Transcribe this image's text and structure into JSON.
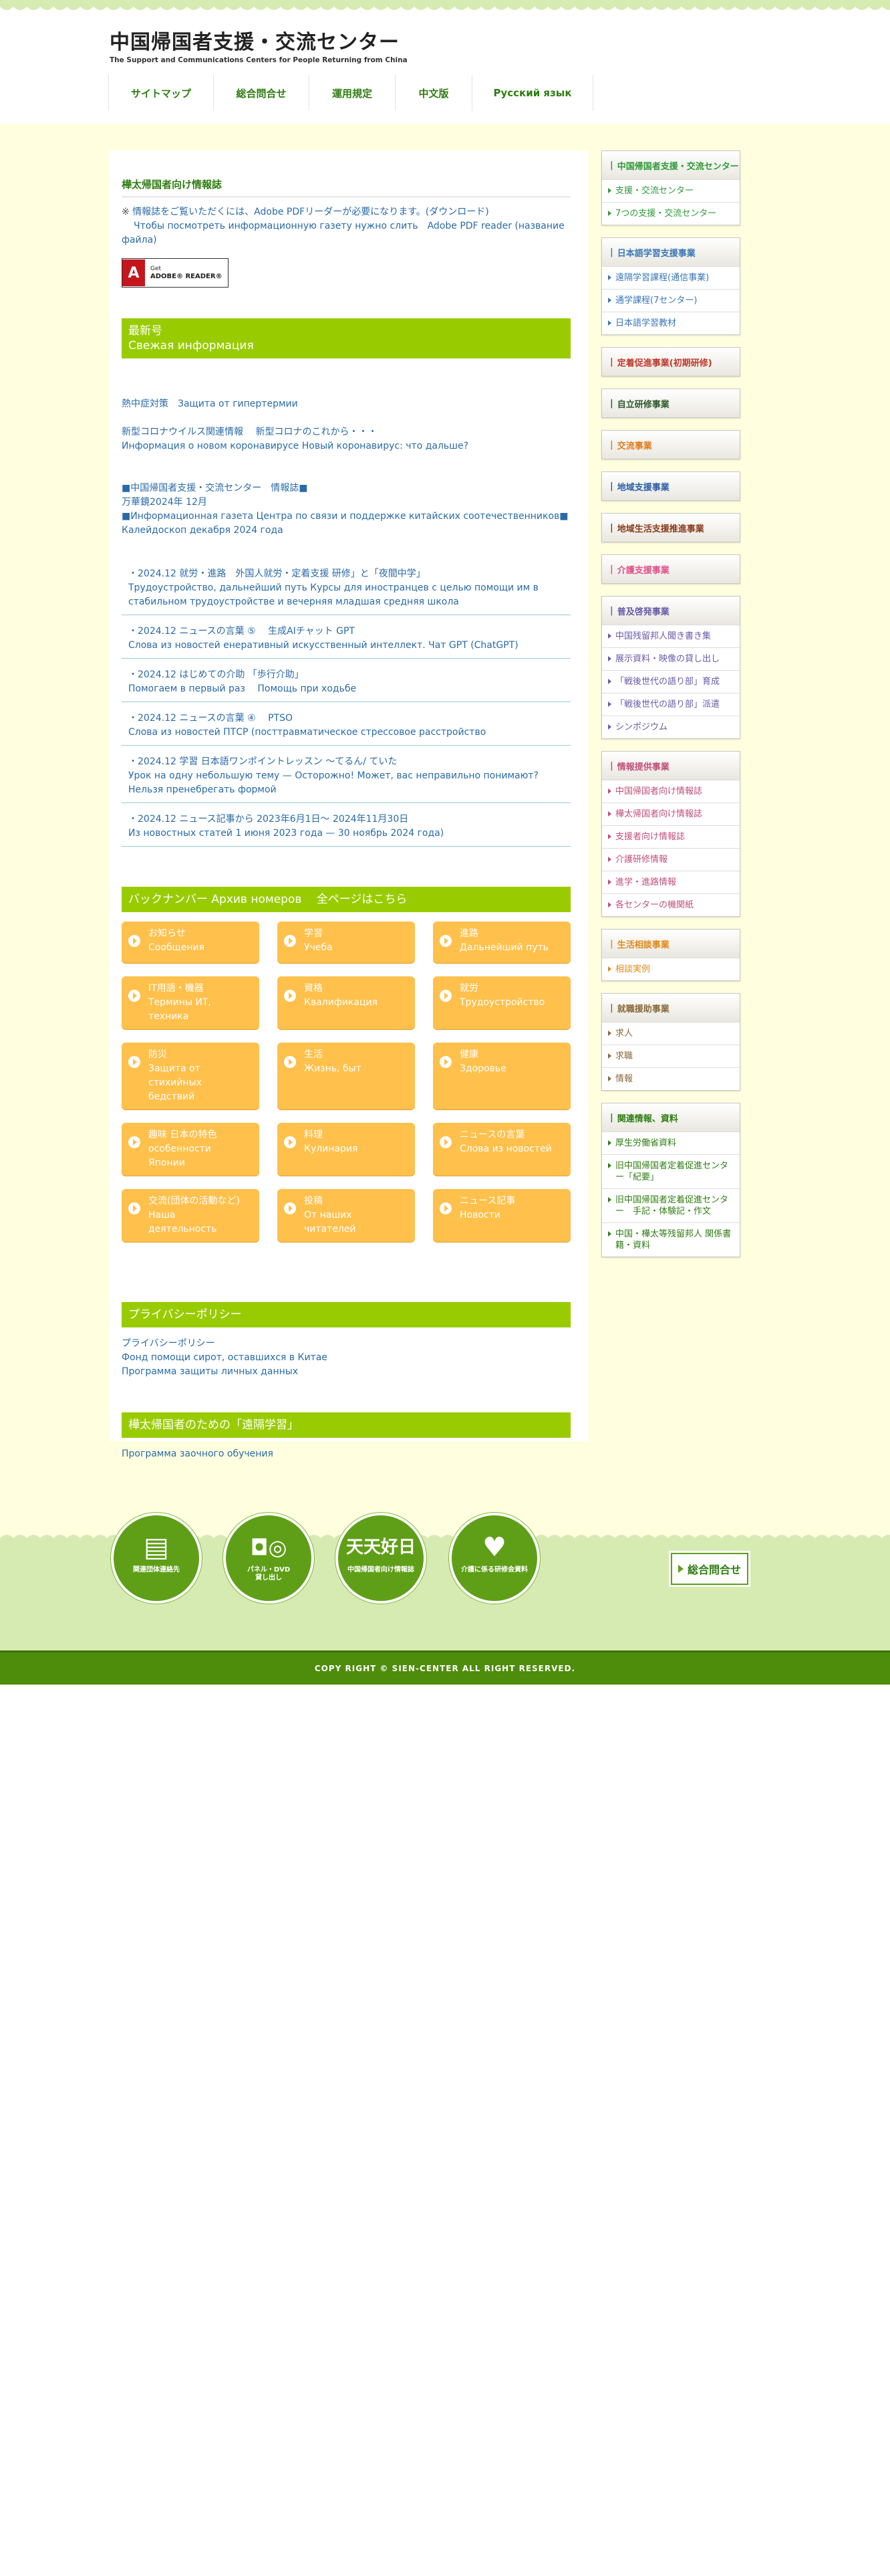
{
  "header": {
    "title": "中国帰国者支援・交流センター",
    "subtitle": "The Support and Communications Centers for People Returning from China"
  },
  "nav": [
    {
      "label": "サイトマップ"
    },
    {
      "label": "総合問合せ"
    },
    {
      "label": "運用規定"
    },
    {
      "label": "中文版"
    },
    {
      "label": "Русский язык"
    }
  ],
  "main": {
    "info_heading": "樺太帰国者向け情報誌",
    "pdf_note_mark": "※",
    "pdf_note_jp": "情報誌をご覧いただくには、Adobe PDFリーダーが必要になります。(ダウンロード)",
    "pdf_note_ru": "Чтобы посмотреть информационную газету нужно слить　Adobe PDF reader (название файла)",
    "adobe": {
      "get": "Get",
      "name": "ADOBE® READER®"
    },
    "latest_jp": "最新号",
    "latest_ru": "Свежая информация",
    "news_lines": [
      "熱中症対策　Защита от гипертермии",
      "",
      "新型コロナウイルス関連情報　 新型コロナのこれから・・・",
      "Информация о новом коронавирусе Новый коронавирус: что дальше?",
      "",
      "",
      "■中国帰国者支援・交流センター　情報誌■",
      "万華鏡2024年 12月",
      "■Информационная газета Центра по связи и поддержке китайских соотечественников■",
      "Калейдоскоп декабря 2024 года"
    ],
    "news_items": [
      {
        "jp": "・2024.12 就労・進路　外国人就労・定着支援 研修」と「夜間中学」",
        "ru": "Трудоустройство, дальнейший путь Курсы для иностранцев с целью помощи им в стабильном трудоустройстве и вечерняя младшая средняя школа"
      },
      {
        "jp": "・2024.12 ニュースの言葉 ⑤　 生成AIチャット GPT",
        "ru": "Слова из новостей енеративный искусственный интеллект. Чат GPT (ChatGPT)"
      },
      {
        "jp": "・2024.12 はじめての介助 「歩行介助」",
        "ru": "Помогаем в первый раз　 Помощь при ходьбе"
      },
      {
        "jp": "・2024.12 ニュースの言葉 ④　 PTSO",
        "ru": "Слова из новостей ПТСР (посттравматическое стрессовое расстройство"
      },
      {
        "jp": "・2024.12 学習 日本語ワンポイントレッスン 〜てるん/ ていた",
        "ru": "Урок на одну небольшую тему — Осторожно! Может, вас неправильно понимают? Нельзя пренебрегать формой"
      },
      {
        "jp": "・2024.12 ニュース記事から 2023年6月1日〜 2024年11月30日",
        "ru": "Из новостных статей 1 июня 2023 года — 30 ноябрь 2024 года)"
      }
    ],
    "backnumber_label": "バックナンバー Архив номеров　 全ページはこちら",
    "backnumber_buttons": [
      {
        "label": "お知らせ\nСообщения"
      },
      {
        "label": "学習\nУчеба"
      },
      {
        "label": "進路\nДальнейший путь"
      },
      {
        "label": "IT用語・機器\nТермины ИТ,\nтехника"
      },
      {
        "label": "資格\nКвалификация"
      },
      {
        "label": "就労\nТрудоустройство"
      },
      {
        "label": "防災\nЗащита от\nстихийных\nбедствий"
      },
      {
        "label": "生活\nЖизнь, быт"
      },
      {
        "label": "健康\nЗдоровье"
      },
      {
        "label": "趣味 日本の特色\nособенности\nЯпонии"
      },
      {
        "label": "料理\nКулинария"
      },
      {
        "label": "ニュースの言葉\nСлова из новостей"
      },
      {
        "label": "交流(団体の活動など)\nНаша\nдеятельность"
      },
      {
        "label": "投稿\nОт наших\nчитателей"
      },
      {
        "label": "ニュース記事\nНовости"
      }
    ],
    "privacy_heading": "プライバシーポリシー",
    "privacy_links": [
      "プライバシーポリシー",
      "Фонд помощи сирот, оставшихся в Китае",
      "Программа защиты личных данных"
    ],
    "distance_heading": "樺太帰国者のための「遠隔学習」",
    "distance_link": "Программа заочного обучения"
  },
  "sidebar": [
    {
      "title": "中国帰国者支援・交流センター",
      "color": "#2f9a3a",
      "items": [
        "支援・交流センター",
        "7つの支援・交流センター"
      ]
    },
    {
      "title": "日本語学習支援事業",
      "color": "#3a78b5",
      "items": [
        "遠隔学習課程(通信事業)",
        "通学課程(7センター)",
        "日本語学習教材"
      ]
    },
    {
      "title": "定着促進事業(初期研修)",
      "color": "#c0392b",
      "items": []
    },
    {
      "title": "自立研修事業",
      "color": "#2e5b2e",
      "items": []
    },
    {
      "title": "交流事業",
      "color": "#e07b1a",
      "items": []
    },
    {
      "title": "地域支援事業",
      "color": "#2b5ea8",
      "items": []
    },
    {
      "title": "地域生活支援推進事業",
      "color": "#8a3a1c",
      "items": []
    },
    {
      "title": "介護支援事業",
      "color": "#e0508a",
      "items": []
    },
    {
      "title": "普及啓発事業",
      "color": "#6a5aa8",
      "items": [
        "中国残留邦人聞き書き集",
        "展示資料・映像の貸し出し",
        "「戦後世代の語り部」育成",
        "「戦後世代の語り部」派遣",
        "シンポジウム"
      ]
    },
    {
      "title": "情報提供事業",
      "color": "#c0507a",
      "items": [
        "中国帰国者向け情報誌",
        "樺太帰国者向け情報誌",
        "支援者向け情報誌",
        "介護研修情報",
        "進学・進路情報",
        "各センターの機関紙"
      ]
    },
    {
      "title": "生活相談事業",
      "color": "#e08a1a",
      "items": [
        "相談実例"
      ]
    },
    {
      "title": "就職援助事業",
      "color": "#8a6a3a",
      "items": [
        "求人",
        "求職",
        "情報"
      ]
    },
    {
      "title": "関連情報、資料",
      "color": "#2f7d12",
      "items": [
        "厚生労働省資料",
        "旧中国帰国者定着促進センター「紀要」",
        "旧中国帰国者定着促進センター　手記・体験記・作文",
        "中国・樺太等残留邦人 関係書籍・資料"
      ]
    }
  ],
  "footer": {
    "icons": [
      {
        "glyph": "▤",
        "caption": "関連団体連絡先"
      },
      {
        "glyph": "◘◎",
        "caption": "パネル・DVD\n貸し出し"
      },
      {
        "glyph": "天天好日",
        "caption": "中国帰国者向け情報誌"
      },
      {
        "glyph": "♥",
        "caption": "介護に係る研修会資料"
      }
    ],
    "contact": "総合問合せ",
    "copyright": "COPY RIGHT © SIEN-CENTER ALL RIGHT RESERVED."
  }
}
